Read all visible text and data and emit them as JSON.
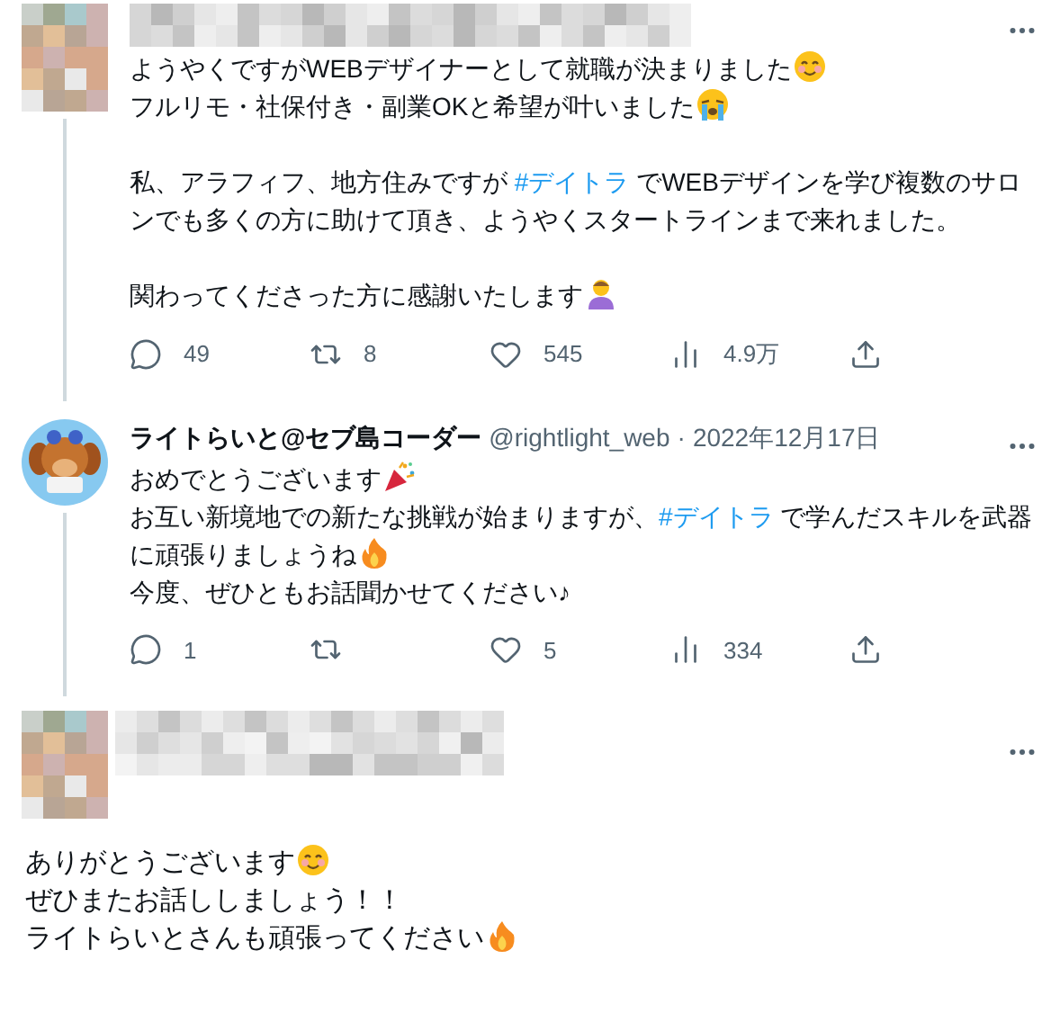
{
  "tweets": [
    {
      "author": {
        "kind": "hidden"
      },
      "paragraphs": [
        [
          {
            "kind": "text",
            "text": "ようやくですがWEBデザイナーとして就職が決まりました"
          },
          {
            "kind": "emoji_smile"
          },
          {
            "kind": "break"
          },
          {
            "kind": "text",
            "text": "フルリモ・社保付き・副業OKと希望が叶いました"
          },
          {
            "kind": "emoji_cry"
          }
        ],
        [
          {
            "kind": "text",
            "text": "私、アラフィフ、地方住みですが "
          },
          {
            "kind": "hashtag",
            "text": "#デイトラ"
          },
          {
            "kind": "text",
            "text": " でWEBデザインを学び複数のサロンでも多くの方に助けて頂き、ようやくスタートラインまで来れました。"
          }
        ],
        [
          {
            "kind": "text",
            "text": "関わってくださった方に感謝いたします"
          },
          {
            "kind": "emoji_person"
          }
        ]
      ],
      "actions": {
        "replies": "49",
        "retweets": "8",
        "likes": "545",
        "views": "4.9万"
      }
    },
    {
      "author": {
        "kind": "shown",
        "name": "ライトらいと@セブ島コーダー",
        "handle": "@rightlight_web",
        "separator": "·",
        "date": "2022年12月17日"
      },
      "paragraphs": [
        [
          {
            "kind": "text",
            "text": "おめでとうございます"
          },
          {
            "kind": "emoji_party"
          },
          {
            "kind": "break"
          },
          {
            "kind": "text",
            "text": "お互い新境地での新たな挑戦が始まりますが、"
          },
          {
            "kind": "hashtag",
            "text": "#デイトラ"
          },
          {
            "kind": "text",
            "text": " で学んだスキルを武器に頑張りましょうね"
          },
          {
            "kind": "emoji_fire"
          },
          {
            "kind": "break"
          },
          {
            "kind": "text",
            "text": "今度、ぜひともお話聞かせてください♪"
          }
        ]
      ],
      "actions": {
        "replies": "1",
        "likes": "5",
        "views": "334"
      }
    },
    {
      "author": {
        "kind": "hidden"
      },
      "paragraphs": [
        [
          {
            "kind": "text",
            "text": "ありがとうございます"
          },
          {
            "kind": "emoji_smile"
          },
          {
            "kind": "break"
          },
          {
            "kind": "text",
            "text": "ぜひまたお話ししましょう！！"
          },
          {
            "kind": "break"
          },
          {
            "kind": "text",
            "text": "ライトらいとさんも頑張ってください"
          },
          {
            "kind": "emoji_fire"
          }
        ]
      ]
    }
  ]
}
